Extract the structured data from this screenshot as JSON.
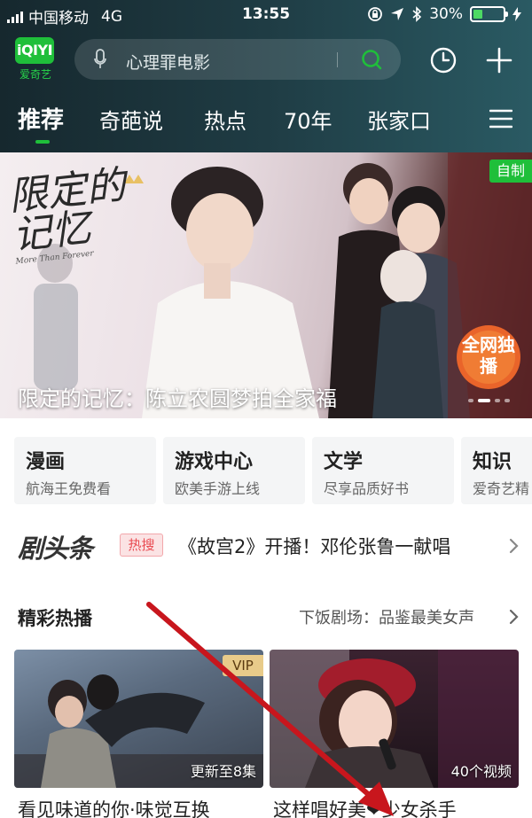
{
  "status_bar": {
    "carrier": "中国移动",
    "network": "4G",
    "time": "13:55",
    "battery": "30%",
    "battery_level": 0.3
  },
  "header": {
    "logo_mark": "iQIYI",
    "logo_name": "爱奇艺",
    "search_placeholder": "心理罪电影",
    "icons": [
      "mic-icon",
      "search-icon",
      "history-clock-icon",
      "plus-icon"
    ]
  },
  "nav_tabs": [
    {
      "label": "推荐",
      "active": true
    },
    {
      "label": "奇葩说",
      "active": false
    },
    {
      "label": "热点",
      "active": false
    },
    {
      "label": "70年",
      "active": false
    },
    {
      "label": "张家口",
      "active": false
    }
  ],
  "banner": {
    "calligraphy": "限定的记忆",
    "calligraphy_sub": "More Than Forever",
    "tag": "自制",
    "exclusive_badge": "全网独播",
    "caption": "限定的记忆：陈立农圆梦拍全家福"
  },
  "channels": [
    {
      "title": "漫画",
      "subtitle": "航海王免费看"
    },
    {
      "title": "游戏中心",
      "subtitle": "欧美手游上线"
    },
    {
      "title": "文学",
      "subtitle": "尽享品质好书"
    },
    {
      "title": "知识",
      "subtitle": "爱奇艺精"
    }
  ],
  "headline": {
    "brand": "剧头条",
    "badge": "热搜",
    "text": "《故宫2》开播！邓伦张鲁一献唱"
  },
  "section": {
    "title": "精彩热播",
    "more": "下饭剧场：品鉴最美女声"
  },
  "cards": [
    {
      "badge": "VIP",
      "info": "更新至8集",
      "title": "看见味道的你·味觉互换"
    },
    {
      "badge": "",
      "info": "40个视频",
      "title": "这样唱好美❤少女杀手"
    }
  ],
  "colors": {
    "brand_green": "#1fbf3a",
    "hot_red": "#e94b52",
    "annotation_arrow": "#c8161d"
  }
}
